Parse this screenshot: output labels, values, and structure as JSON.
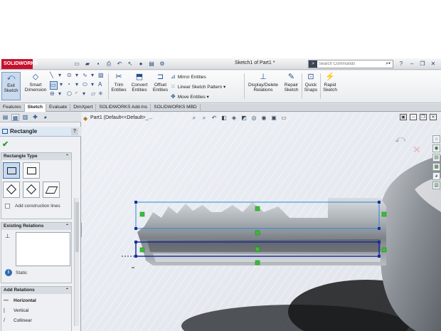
{
  "app": {
    "brand": "SOLIDWORKS",
    "document_title": "Sketch1 of Part1 *",
    "search_placeholder": "Search Commands"
  },
  "ribbon": {
    "exit_sketch": "Exit Sketch",
    "smart_dimension": "Smart Dimension",
    "trim_entities": "Trim Entities",
    "convert_entities": "Convert Entities",
    "offset_entities": "Offset Entities",
    "mirror_entities": "Mirror Entities",
    "linear_sketch_pattern": "Linear Sketch Pattern",
    "move_entities": "Move Entities",
    "display_delete_relations": "Display/Delete Relations",
    "repair_sketch": "Repair Sketch",
    "quick_snaps": "Quick Snaps",
    "rapid_sketch": "Rapid Sketch"
  },
  "tabs": [
    "Features",
    "Sketch",
    "Evaluate",
    "DimXpert",
    "SOLIDWORKS Add-Ins",
    "SOLIDWORKS MBD"
  ],
  "active_tab": "Sketch",
  "property_manager": {
    "title": "Rectangle",
    "help": "?",
    "rectangle_type": {
      "header": "Rectangle Type",
      "add_construction_lines": "Add construction lines"
    },
    "existing_relations": {
      "header": "Existing Relations",
      "status": "Static"
    },
    "add_relations": {
      "header": "Add Relations",
      "items": [
        "Horizontal",
        "Vertical",
        "Collinear"
      ]
    }
  },
  "graphics": {
    "feature_tree_item": "Part1  (Default<<Default>_..."
  },
  "colors": {
    "accent": "#244f8f",
    "sketch_line": "#1b2f9c",
    "sketch_line_selected": "#2a8bd6",
    "relation_marker": "#33c233"
  },
  "icons": {
    "confirm": "check-icon",
    "help": "help-icon",
    "info": "info-icon"
  }
}
